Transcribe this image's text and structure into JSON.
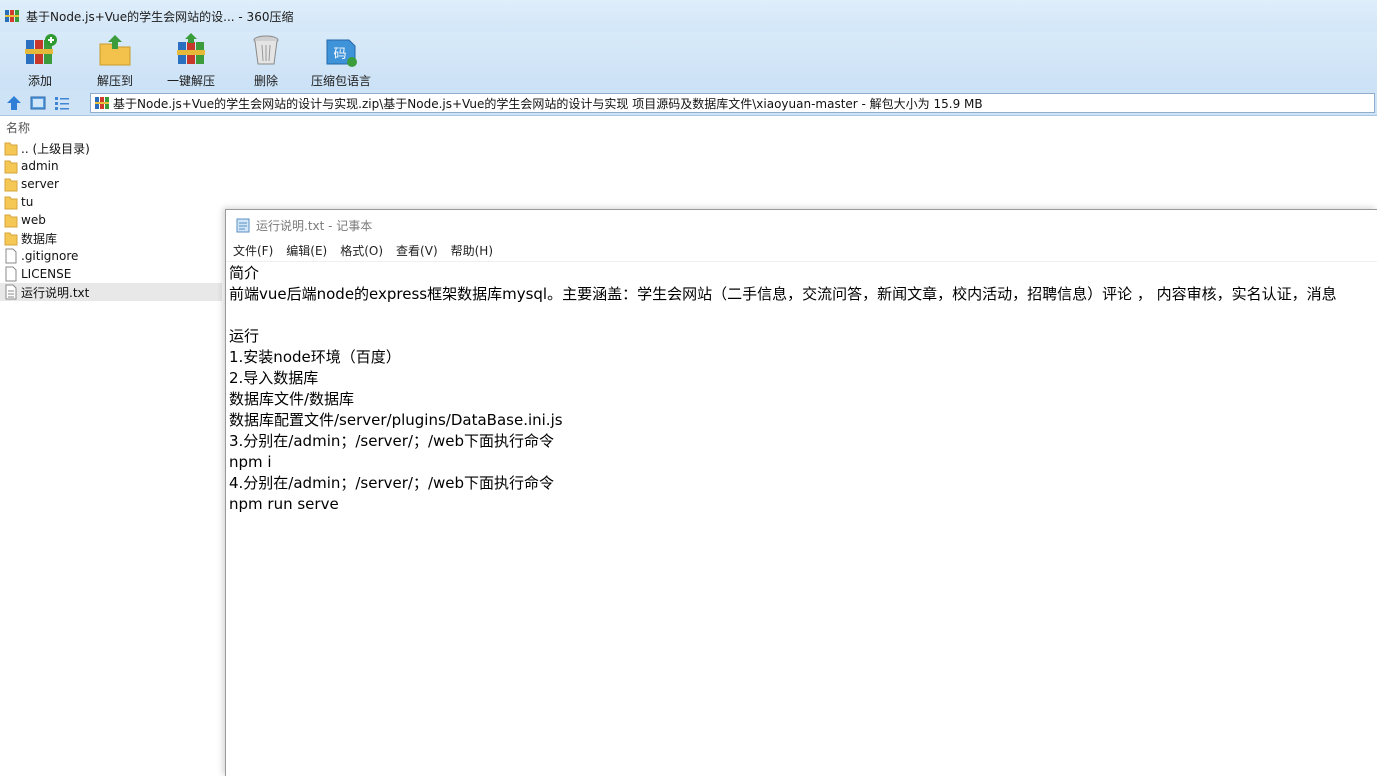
{
  "window": {
    "title": "基于Node.js+Vue的学生会网站的设... - 360压缩"
  },
  "toolbar": {
    "buttons": [
      {
        "label": "添加",
        "icon": "add-books-icon"
      },
      {
        "label": "解压到",
        "icon": "extract-to-folder-icon"
      },
      {
        "label": "一键解压",
        "icon": "one-click-extract-icon"
      },
      {
        "label": "删除",
        "icon": "trash-can-icon"
      },
      {
        "label": "压缩包语言",
        "icon": "archive-language-icon"
      }
    ]
  },
  "address": {
    "path": "基于Node.js+Vue的学生会网站的设计与实现.zip\\基于Node.js+Vue的学生会网站的设计与实现 项目源码及数据库文件\\xiaoyuan-master - 解包大小为 15.9 MB"
  },
  "filelist": {
    "column_header": "名称",
    "items": [
      {
        "name": ".. (上级目录)",
        "type": "folder"
      },
      {
        "name": "admin",
        "type": "folder"
      },
      {
        "name": "server",
        "type": "folder"
      },
      {
        "name": "tu",
        "type": "folder"
      },
      {
        "name": "web",
        "type": "folder"
      },
      {
        "name": "数据库",
        "type": "folder"
      },
      {
        "name": ".gitignore",
        "type": "file"
      },
      {
        "name": "LICENSE",
        "type": "file"
      },
      {
        "name": "运行说明.txt",
        "type": "text-file",
        "selected": true
      }
    ]
  },
  "notepad": {
    "title": "运行说明.txt - 记事本",
    "menu": [
      "文件(F)",
      "编辑(E)",
      "格式(O)",
      "查看(V)",
      "帮助(H)"
    ],
    "content": "简介\n前端vue后端node的express框架数据库mysql。主要涵盖：学生会网站（二手信息，交流问答，新闻文章，校内活动，招聘信息）评论 ， 内容审核，实名认证，消息\n\n运行\n1.安装node环境（百度）\n2.导入数据库\n数据库文件/数据库\n数据库配置文件/server/plugins/DataBase.ini.js\n3.分别在/admin；/server/；/web下面执行命令\nnpm i\n4.分别在/admin；/server/；/web下面执行命令\nnpm run serve"
  }
}
